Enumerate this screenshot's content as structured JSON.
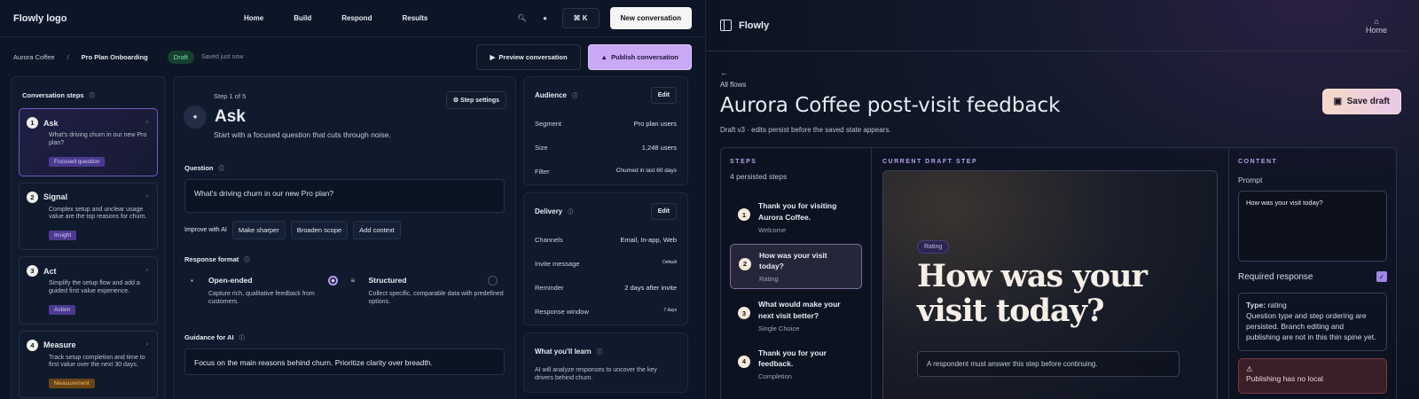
{
  "left": {
    "logo": "Flowly logo",
    "nav": [
      "Home",
      "Build",
      "Respond",
      "Results"
    ],
    "shortcut": "⌘ K",
    "new_conversation": "New conversation",
    "breadcrumb": {
      "org": "Aurora Coffee",
      "sep": "/",
      "page": "Pro Plan Onboarding"
    },
    "status_badge": "Draft",
    "saved": "Saved just now",
    "preview_label": "Preview conversation",
    "publish_label": "Publish conversation",
    "steps_title": "Conversation steps",
    "steps": [
      {
        "num": "1",
        "title": "Ask",
        "desc": "What's driving churn in our new Pro plan?",
        "tag": "Focused question"
      },
      {
        "num": "2",
        "title": "Signal",
        "desc": "Complex setup and unclear usage value are the top reasons for churn.",
        "tag": "Insight"
      },
      {
        "num": "3",
        "title": "Act",
        "desc": "Simplify the setup flow and add a guided first value experience.",
        "tag": "Action"
      },
      {
        "num": "4",
        "title": "Measure",
        "desc": "Track setup completion and time to first value over the next 30 days.",
        "tag": "Measurement"
      }
    ],
    "editor": {
      "step_meta": "Step 1 of 5",
      "step_settings": "Step settings",
      "title": "Ask",
      "subtitle": "Start with a focused question that cuts through noise.",
      "question_label": "Question",
      "question_value": "What's driving churn in our new Pro plan?",
      "improve_label": "Improve with AI",
      "ai_chips": [
        "Make sharper",
        "Broaden scope",
        "Add context"
      ],
      "format_label": "Response format",
      "formats": [
        {
          "title": "Open-ended",
          "desc": "Capture rich, qualitative feedback from customers."
        },
        {
          "title": "Structured",
          "desc": "Collect specific, comparable data with predefined options."
        }
      ],
      "guidance_label": "Guidance for AI",
      "guidance_value": "Focus on the main reasons behind churn. Prioritize clarity over breadth."
    },
    "audience": {
      "title": "Audience",
      "edit": "Edit",
      "rows": [
        {
          "k": "Segment",
          "v": "Pro plan users"
        },
        {
          "k": "Size",
          "v": "1,248 users"
        },
        {
          "k": "Filter",
          "v": "Churned in last 60 days"
        }
      ]
    },
    "delivery": {
      "title": "Delivery",
      "edit": "Edit",
      "rows": [
        {
          "k": "Channels",
          "v": "Email, In-app, Web"
        },
        {
          "k": "Invite message",
          "v": "Default"
        },
        {
          "k": "Reminder",
          "v": "2 days after invite"
        },
        {
          "k": "Response window",
          "v": "7 days"
        }
      ]
    },
    "learn": {
      "title": "What you'll learn",
      "desc": "AI will analyze responses to uncover the key drivers behind churn."
    }
  },
  "right": {
    "brand": "Flowly",
    "home": "Home",
    "back_icon": "arrow-left-icon",
    "all_flows": "All flows",
    "title": "Aurora Coffee post-visit feedback",
    "subtitle": "Draft v3 · edits persist before the saved state appears.",
    "save_draft": "Save draft",
    "steps_label": "STEPS",
    "steps_count": "4 persisted steps",
    "steps": [
      {
        "num": "1",
        "title": "Thank you for visiting Aurora Coffee.",
        "kind": "Welcome"
      },
      {
        "num": "2",
        "title": "How was your visit today?",
        "kind": "Rating"
      },
      {
        "num": "3",
        "title": "What would make your next visit better?",
        "kind": "Single Choice"
      },
      {
        "num": "4",
        "title": "Thank you for your feedback.",
        "kind": "Completion"
      }
    ],
    "draft_label": "CURRENT DRAFT STEP",
    "draft_badge": "Rating",
    "draft_question": "How was your visit today?",
    "draft_note": "A respondent must answer this step before continuing.",
    "content_label": "CONTENT",
    "prompt_label": "Prompt",
    "prompt_value": "How was your visit today?",
    "required_label": "Required response",
    "type_key": "Type:",
    "type_value": "rating",
    "type_note": "Question type and step ordering are persisted. Branch editing and publishing are not in this thin spine yet.",
    "warning": "Publishing has no local"
  }
}
